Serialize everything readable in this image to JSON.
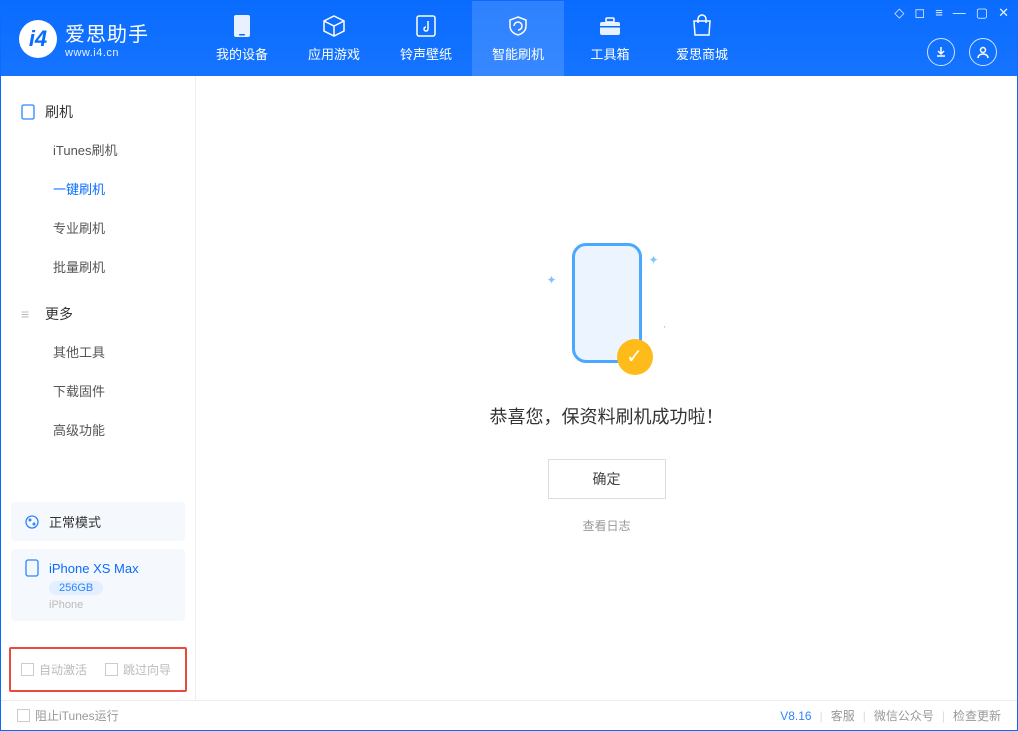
{
  "app": {
    "title": "爱思助手",
    "subtitle": "www.i4.cn"
  },
  "nav": {
    "tabs": [
      {
        "label": "我的设备"
      },
      {
        "label": "应用游戏"
      },
      {
        "label": "铃声壁纸"
      },
      {
        "label": "智能刷机"
      },
      {
        "label": "工具箱"
      },
      {
        "label": "爱思商城"
      }
    ]
  },
  "sidebar": {
    "section1": {
      "title": "刷机",
      "items": [
        {
          "label": "iTunes刷机"
        },
        {
          "label": "一键刷机"
        },
        {
          "label": "专业刷机"
        },
        {
          "label": "批量刷机"
        }
      ]
    },
    "section2": {
      "title": "更多",
      "items": [
        {
          "label": "其他工具"
        },
        {
          "label": "下载固件"
        },
        {
          "label": "高级功能"
        }
      ]
    },
    "mode_card": {
      "label": "正常模式"
    },
    "device_card": {
      "name": "iPhone XS Max",
      "storage": "256GB",
      "type": "iPhone"
    },
    "bottom": {
      "auto_activate": "自动激活",
      "skip_guide": "跳过向导"
    }
  },
  "main": {
    "success_text": "恭喜您，保资料刷机成功啦！",
    "ok_button": "确定",
    "view_log": "查看日志"
  },
  "statusbar": {
    "block_itunes": "阻止iTunes运行",
    "version": "V8.16",
    "support": "客服",
    "wechat": "微信公众号",
    "check_update": "检查更新"
  }
}
